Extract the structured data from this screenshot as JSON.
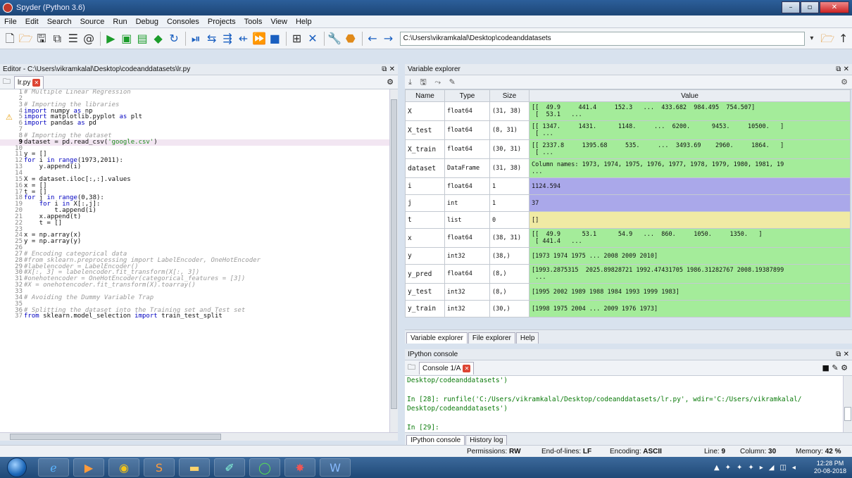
{
  "window": {
    "title": "Spyder (Python 3.6)"
  },
  "menu": [
    "File",
    "Edit",
    "Search",
    "Source",
    "Run",
    "Debug",
    "Consoles",
    "Projects",
    "Tools",
    "View",
    "Help"
  ],
  "toolbar": {
    "path": "C:\\Users\\vikramkalal\\Desktop\\codeanddatasets"
  },
  "editor": {
    "header": "Editor - C:\\Users\\vikramkalal\\Desktop\\codeanddatasets\\lr.py",
    "tab": "lr.py",
    "current_line": 9,
    "warning_line": 5,
    "lines": [
      "# Multiple Linear Regression",
      "",
      "# Importing the libraries",
      "import numpy as np",
      "import matplotlib.pyplot as plt",
      "import pandas as pd",
      "",
      "# Importing the dataset",
      "dataset = pd.read_csv('google.csv')",
      "",
      "y = []",
      "for i in range(1973,2011):",
      "    y.append(i)",
      "",
      "X = dataset.iloc[:,:].values",
      "x = []",
      "t = []",
      "for j in range(0,38):",
      "    for i in X[:,j]:",
      "        t.append(i)",
      "    x.append(t)",
      "    t = []",
      "",
      "x = np.array(x)",
      "y = np.array(y)",
      "",
      "# Encoding categorical data",
      "#from sklearn.preprocessing import LabelEncoder, OneHotEncoder",
      "#labelencoder = LabelEncoder()",
      "#X[:, 3] = labelencoder.fit_transform(X[:, 3])",
      "#onehotencoder = OneHotEncoder(categorical_features = [3])",
      "#X = onehotencoder.fit_transform(X).toarray()",
      "",
      "# Avoiding the Dummy Variable Trap",
      "",
      "# Splitting the dataset into the Training set and Test set",
      "from sklearn.model_selection import train_test_split"
    ]
  },
  "variable_explorer": {
    "header": "Variable explorer",
    "columns": [
      "Name",
      "Type",
      "Size",
      "Value"
    ],
    "rows": [
      {
        "name": "X",
        "type": "float64",
        "size": "(31, 38)",
        "value": "[[  49.9     441.4     152.3   ...  433.682  984.495  754.507]\n [  53.1   ...",
        "color": "#a4ec9a"
      },
      {
        "name": "X_test",
        "type": "float64",
        "size": "(8, 31)",
        "value": "[[ 1347.     1431.      1148.     ...  6200.      9453.     10500.   ]\n [ ...",
        "color": "#a4ec9a"
      },
      {
        "name": "X_train",
        "type": "float64",
        "size": "(30, 31)",
        "value": "[[ 2337.8     1395.68     535.     ...  3493.69    2960.     1864.   ]\n [ ...",
        "color": "#a4ec9a"
      },
      {
        "name": "dataset",
        "type": "DataFrame",
        "size": "(31, 38)",
        "value": "Column names: 1973, 1974, 1975, 1976, 1977, 1978, 1979, 1980, 1981, 19\n...",
        "color": "#a4ec9a"
      },
      {
        "name": "i",
        "type": "float64",
        "size": "1",
        "value": "1124.594",
        "color": "#aaa8ea"
      },
      {
        "name": "j",
        "type": "int",
        "size": "1",
        "value": "37",
        "color": "#aaa8ea"
      },
      {
        "name": "t",
        "type": "list",
        "size": "0",
        "value": "[]",
        "color": "#f0eaa4"
      },
      {
        "name": "x",
        "type": "float64",
        "size": "(38, 31)",
        "value": "[[  49.9      53.1      54.9   ...  860.     1050.     1350.   ]\n [ 441.4   ...",
        "color": "#a4ec9a"
      },
      {
        "name": "y",
        "type": "int32",
        "size": "(38,)",
        "value": "[1973 1974 1975 ... 2008 2009 2010]",
        "color": "#a4ec9a"
      },
      {
        "name": "y_pred",
        "type": "float64",
        "size": "(8,)",
        "value": "[1993.2875315  2025.89828721 1992.47431705 1986.31282767 2008.19387899\n ...",
        "color": "#a4ec9a"
      },
      {
        "name": "y_test",
        "type": "int32",
        "size": "(8,)",
        "value": "[1995 2002 1989 1988 1984 1993 1999 1983]",
        "color": "#a4ec9a"
      },
      {
        "name": "y_train",
        "type": "int32",
        "size": "(30,)",
        "value": "[1998 1975 2004 ... 2009 1976 1973]",
        "color": "#a4ec9a"
      }
    ],
    "tabs": [
      "Variable explorer",
      "File explorer",
      "Help"
    ]
  },
  "console": {
    "header": "IPython console",
    "tab": "Console 1/A",
    "lines": [
      "Desktop/codeanddatasets')",
      "",
      "In [28]: runfile('C:/Users/vikramkalal/Desktop/codeanddatasets/lr.py', wdir='C:/Users/vikramkalal/",
      "Desktop/codeanddatasets')",
      "",
      "In [29]:"
    ],
    "tabs": [
      "IPython console",
      "History log"
    ]
  },
  "status": {
    "permissions_label": "Permissions:",
    "permissions": "RW",
    "eol_label": "End-of-lines:",
    "eol": "LF",
    "encoding_label": "Encoding:",
    "encoding": "ASCII",
    "line_label": "Line:",
    "line": "9",
    "column_label": "Column:",
    "column": "30",
    "memory_label": "Memory:",
    "memory": "42 %"
  },
  "taskbar": {
    "time": "12:28 PM",
    "date": "20-08-2018"
  }
}
